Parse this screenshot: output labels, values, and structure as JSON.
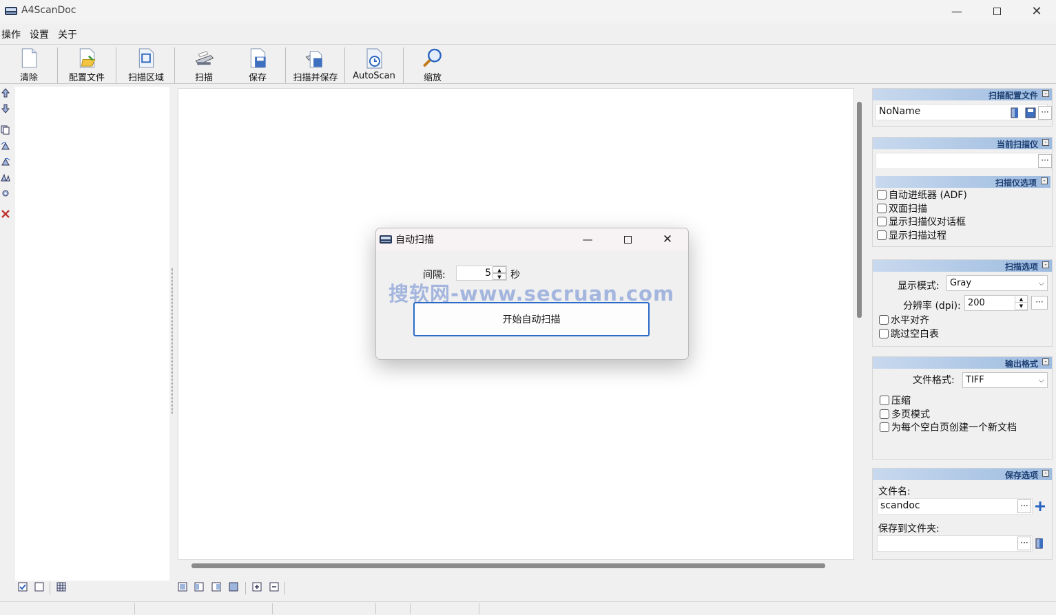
{
  "window": {
    "title": "A4ScanDoc"
  },
  "menu": [
    "操作",
    "设置",
    "关于"
  ],
  "toolbar": [
    {
      "label": "清除",
      "icon": "blank-page-icon"
    },
    {
      "label": "配置文件",
      "icon": "profile-folder-icon"
    },
    {
      "label": "扫描区域",
      "icon": "scan-area-icon"
    },
    {
      "label": "扫描",
      "icon": "scanner-icon"
    },
    {
      "label": "保存",
      "icon": "save-disk-icon"
    },
    {
      "label": "扫描并保存",
      "icon": "scan-save-icon"
    },
    {
      "label": "AutoScan",
      "icon": "autoscan-icon"
    },
    {
      "label": "缩放",
      "icon": "magnifier-icon"
    }
  ],
  "right_panel": {
    "profile": {
      "title": "扫描配置文件",
      "name": "NoName"
    },
    "scanner": {
      "title": "当前扫描仪",
      "value": ""
    },
    "scanner_options": {
      "title": "扫描仪选项",
      "checkboxes": [
        "自动进纸器 (ADF)",
        "双面扫描",
        "显示扫描仪对话框",
        "显示扫描过程"
      ]
    },
    "scan_options": {
      "title": "扫描选项",
      "display_mode_label": "显示模式:",
      "display_mode": "Gray",
      "resolution_label": "分辨率 (dpi):",
      "resolution": "200",
      "checkboxes": [
        "水平对齐",
        "跳过空白表"
      ]
    },
    "output_format": {
      "title": "输出格式",
      "format_label": "文件格式:",
      "format": "TIFF",
      "checkboxes": [
        "压缩",
        "多页模式",
        "为每个空白页创建一个新文档"
      ]
    },
    "save_options": {
      "title": "保存选项",
      "filename_label": "文件名:",
      "filename": "scandoc",
      "folder_label": "保存到文件夹:",
      "folder": ""
    }
  },
  "dialog": {
    "title": "自动扫描",
    "interval_label": "间隔:",
    "interval_value": "5",
    "unit": "秒",
    "start_button": "开始自动扫描",
    "watermark": "搜软网-www.secruan.com"
  }
}
